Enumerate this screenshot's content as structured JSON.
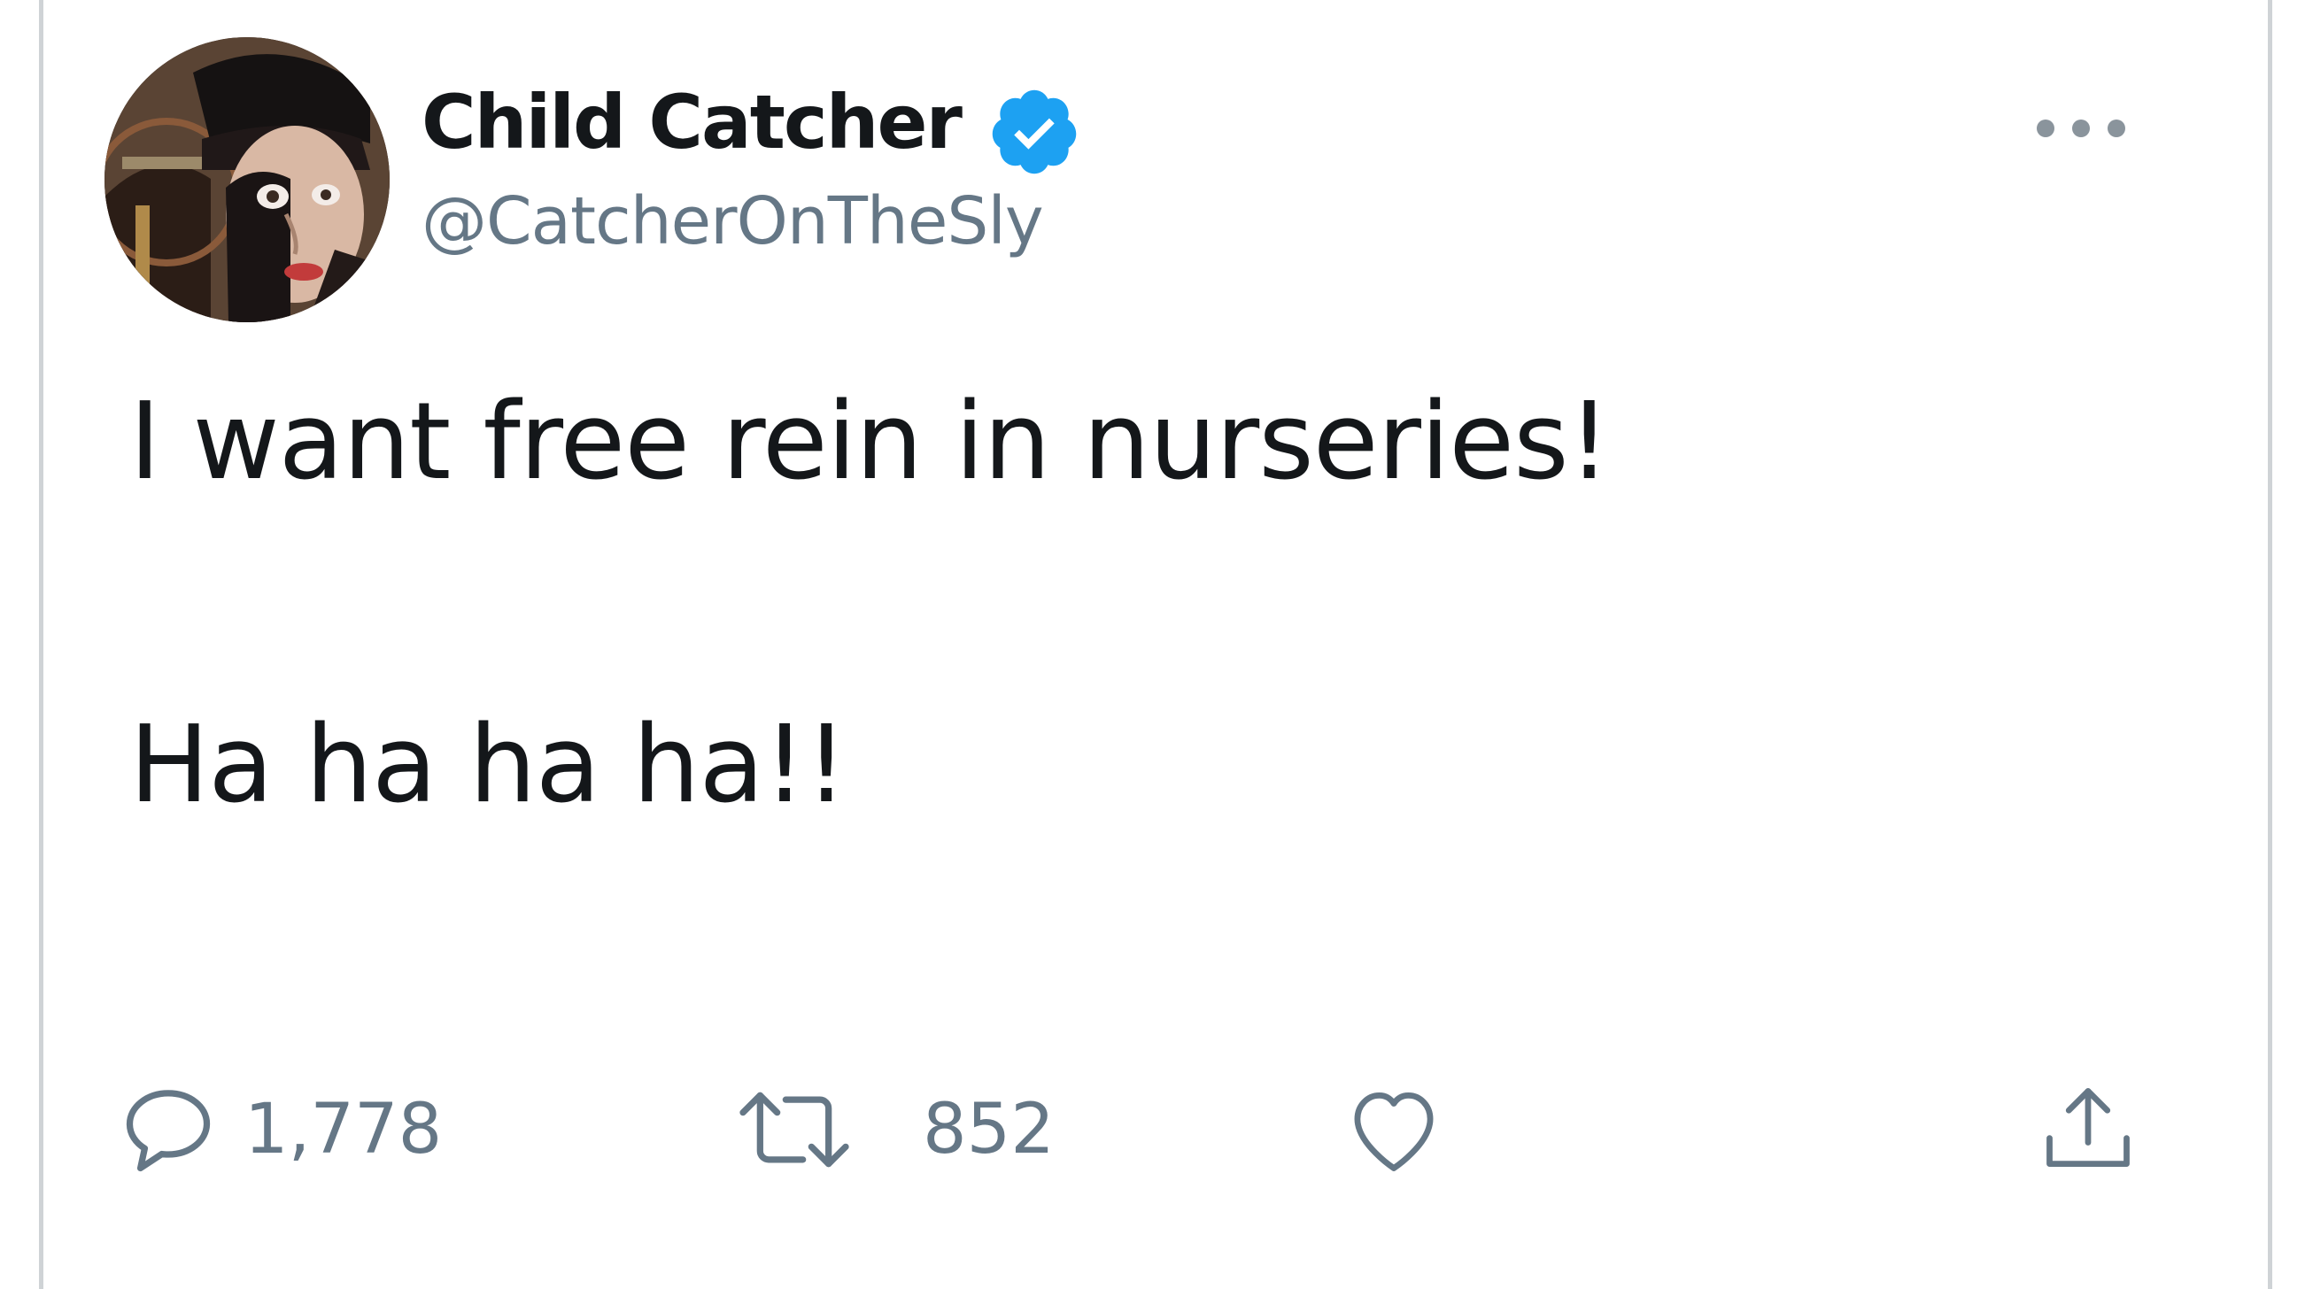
{
  "tweet": {
    "author": {
      "display_name": "Child Catcher",
      "handle": "@CatcherOnTheSly",
      "verified": true
    },
    "text_lines": [
      "I want free rein in nurseries!",
      "Ha ha ha ha!!"
    ],
    "actions": {
      "reply_count": "1,778",
      "retweet_count": "852"
    }
  },
  "colors": {
    "text_primary": "#14171a",
    "text_secondary": "#657786",
    "verified_blue": "#1da1f2",
    "border": "#cfd3d6"
  },
  "icons": {
    "more": "more-horizontal-icon",
    "verified": "verified-badge-icon",
    "reply": "reply-icon",
    "retweet": "retweet-icon",
    "like": "heart-icon",
    "share": "share-icon"
  }
}
